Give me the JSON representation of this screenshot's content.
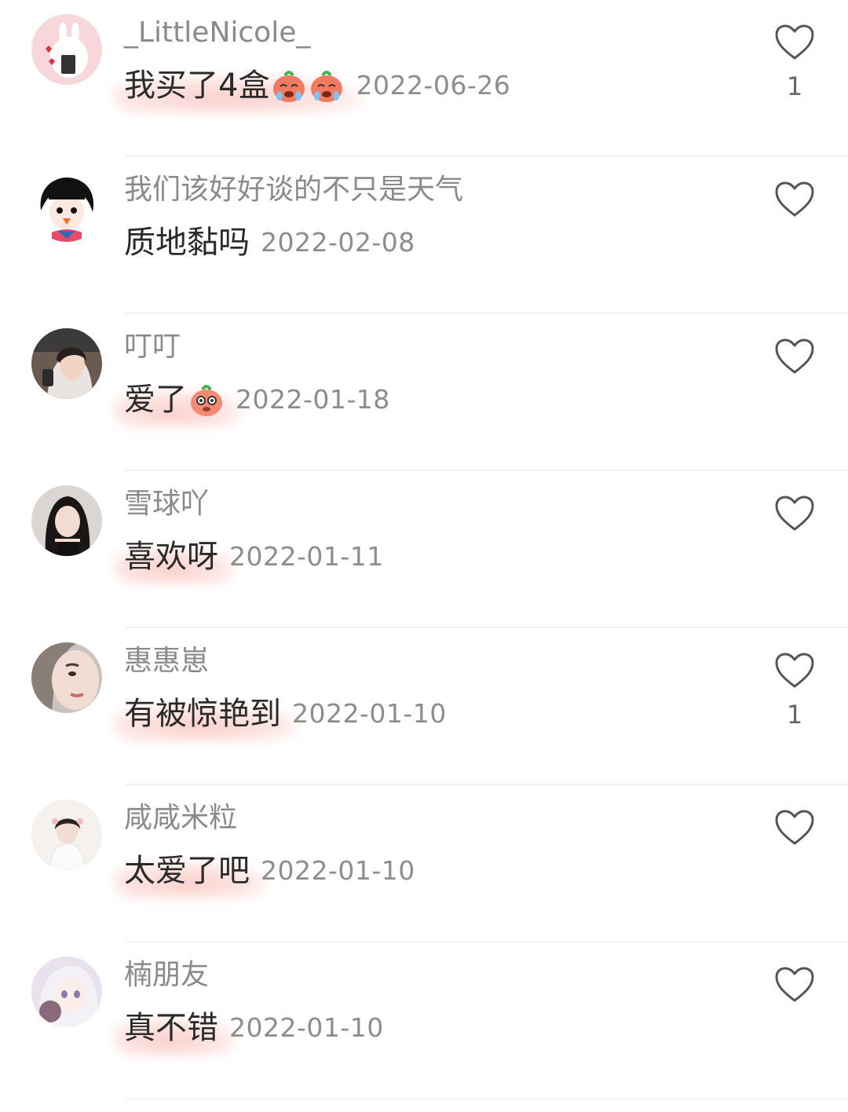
{
  "comments": [
    {
      "username": "_LittleNicole_",
      "text": "我买了4盒",
      "emoji_name": "crying-radish-emoji",
      "date": "2022-06-26",
      "likes": "1",
      "avatar_name": "cartoon-bunny-avatar"
    },
    {
      "username": "我们该好好谈的不只是天气",
      "text": "质地黏吗",
      "date": "2022-02-08",
      "likes": "",
      "avatar_name": "cartoon-girl-avatar"
    },
    {
      "username": "叮叮",
      "text": "爱了",
      "emoji_name": "shy-radish-emoji",
      "date": "2022-01-18",
      "likes": "",
      "avatar_name": "user-photo-avatar"
    },
    {
      "username": "雪球吖",
      "text": "喜欢呀",
      "date": "2022-01-11",
      "likes": "",
      "avatar_name": "user-photo-avatar"
    },
    {
      "username": "惠惠崽",
      "text": "有被惊艳到",
      "date": "2022-01-10",
      "likes": "1",
      "avatar_name": "user-photo-avatar"
    },
    {
      "username": "咸咸米粒",
      "text": "太爱了吧",
      "date": "2022-01-10",
      "likes": "",
      "avatar_name": "user-photo-avatar"
    },
    {
      "username": "楠朋友",
      "text": "真不错",
      "date": "2022-01-10",
      "likes": "",
      "avatar_name": "anime-girl-avatar"
    }
  ],
  "icons": {
    "like": "heart-outline-icon"
  },
  "colors": {
    "username": "#8a8a8a",
    "text": "#2a2a2a",
    "date": "#8d8d8d",
    "highlight": "#f6968c",
    "divider": "#f1f1f1"
  }
}
